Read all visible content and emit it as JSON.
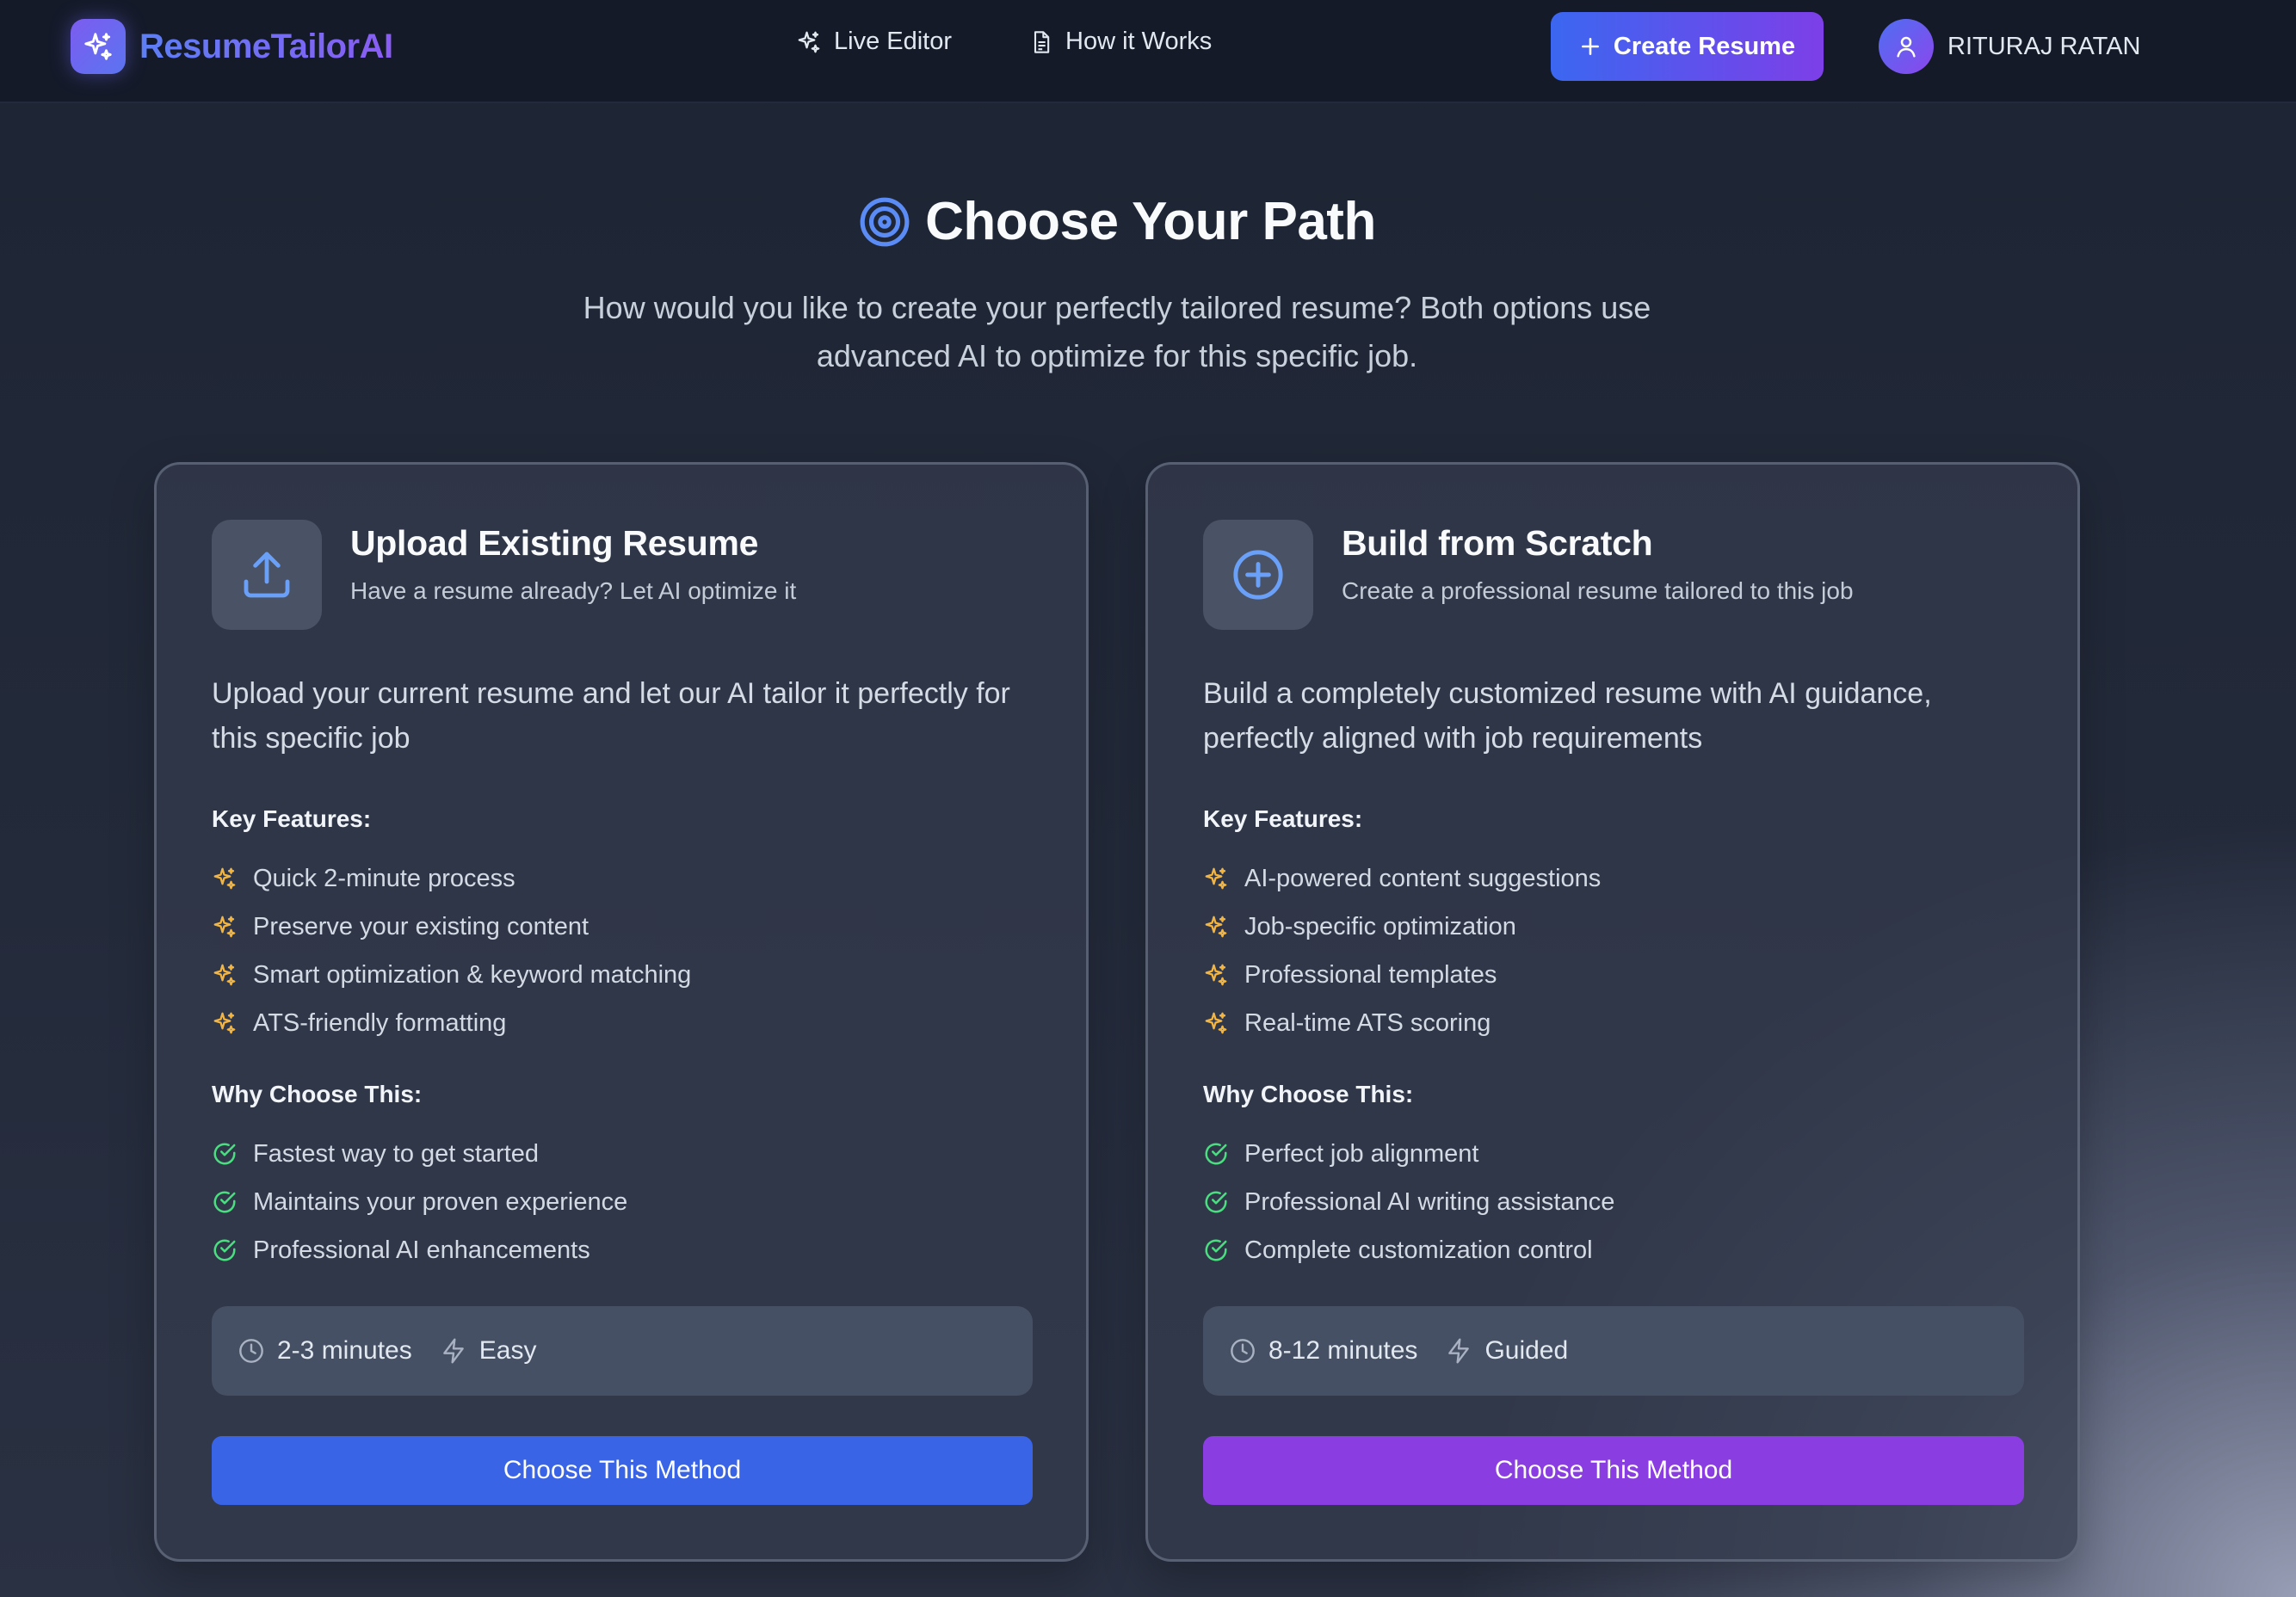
{
  "nav": {
    "logo_text": "ResumeTailorAI",
    "links": [
      {
        "label": "Live Editor",
        "icon": "sparkles-icon"
      },
      {
        "label": "How it Works",
        "icon": "document-icon"
      }
    ],
    "create_button": "Create Resume",
    "user_name": "RITURAJ RATAN"
  },
  "hero": {
    "title": "Choose Your Path",
    "subtitle": "How would you like to create your perfectly tailored resume? Both options use advanced AI to optimize for this specific job."
  },
  "cards": [
    {
      "title": "Upload Existing Resume",
      "subtitle": "Have a resume already? Let AI optimize it",
      "description": "Upload your current resume and let our AI tailor it perfectly for this specific job",
      "features_label": "Key Features:",
      "features": [
        "Quick 2-minute process",
        "Preserve your existing content",
        "Smart optimization & keyword matching",
        "ATS-friendly formatting"
      ],
      "why_label": "Why Choose This:",
      "why": [
        "Fastest way to get started",
        "Maintains your proven experience",
        "Professional AI enhancements"
      ],
      "time": "2-3 minutes",
      "difficulty": "Easy",
      "button": "Choose This Method",
      "button_color": "#3a64e6"
    },
    {
      "title": "Build from Scratch",
      "subtitle": "Create a professional resume tailored to this job",
      "description": "Build a completely customized resume with AI guidance, perfectly aligned with job requirements",
      "features_label": "Key Features:",
      "features": [
        "AI-powered content suggestions",
        "Job-specific optimization",
        "Professional templates",
        "Real-time ATS scoring"
      ],
      "why_label": "Why Choose This:",
      "why": [
        "Perfect job alignment",
        "Professional AI writing assistance",
        "Complete customization control"
      ],
      "time": "8-12 minutes",
      "difficulty": "Guided",
      "button": "Choose This Method",
      "button_color": "#8a3ee2"
    }
  ],
  "colors": {
    "accent_blue": "#3b67f0",
    "accent_purple": "#7d3fe8",
    "feature_star": "#f5b53d",
    "check_green": "#4ade80"
  }
}
